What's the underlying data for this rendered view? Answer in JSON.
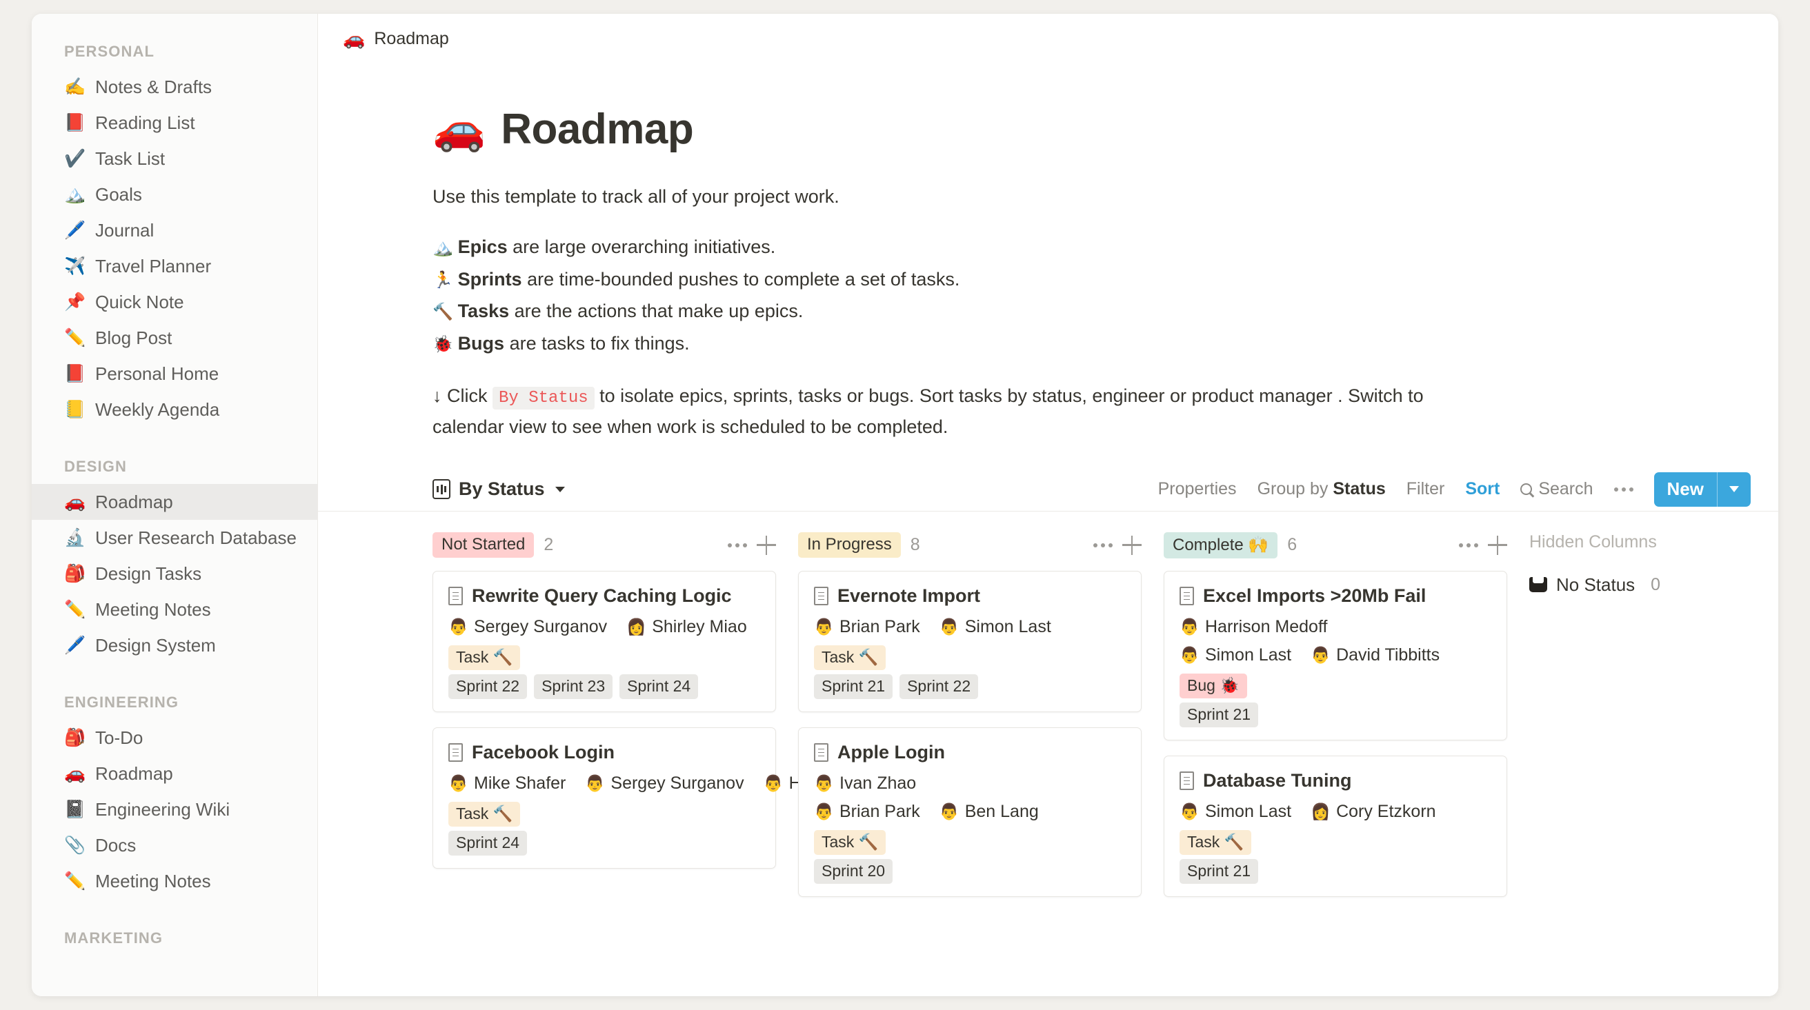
{
  "sidebar": {
    "sections": [
      {
        "title": "PERSONAL",
        "items": [
          {
            "emoji": "✍️",
            "label": "Notes & Drafts",
            "icon": "writing-hand-icon",
            "active": false
          },
          {
            "emoji": "📕",
            "label": "Reading List",
            "icon": "closed-book-icon",
            "active": false
          },
          {
            "emoji": "✔️",
            "label": "Task List",
            "icon": "check-mark-icon",
            "active": false
          },
          {
            "emoji": "🏔️",
            "label": "Goals",
            "icon": "mountain-icon",
            "active": false
          },
          {
            "emoji": "🖊️",
            "label": "Journal",
            "icon": "pen-icon",
            "active": false
          },
          {
            "emoji": "✈️",
            "label": "Travel Planner",
            "icon": "airplane-icon",
            "active": false
          },
          {
            "emoji": "📌",
            "label": "Quick Note",
            "icon": "pushpin-icon",
            "active": false
          },
          {
            "emoji": "✏️",
            "label": "Blog Post",
            "icon": "pencil-icon",
            "active": false
          },
          {
            "emoji": "📕",
            "label": "Personal Home",
            "icon": "closed-book-icon",
            "active": false
          },
          {
            "emoji": "📒",
            "label": "Weekly Agenda",
            "icon": "ledger-icon",
            "active": false
          }
        ]
      },
      {
        "title": "DESIGN",
        "items": [
          {
            "emoji": "🚗",
            "label": "Roadmap",
            "icon": "car-icon",
            "active": true
          },
          {
            "emoji": "🔬",
            "label": "User Research Database",
            "icon": "microscope-icon",
            "active": false
          },
          {
            "emoji": "🎒",
            "label": "Design Tasks",
            "icon": "backpack-icon",
            "active": false
          },
          {
            "emoji": "✏️",
            "label": "Meeting Notes",
            "icon": "pencil-icon",
            "active": false
          },
          {
            "emoji": "🖊️",
            "label": "Design System",
            "icon": "pen-icon",
            "active": false
          }
        ]
      },
      {
        "title": "ENGINEERING",
        "items": [
          {
            "emoji": "🎒",
            "label": "To-Do",
            "icon": "backpack-icon",
            "active": false
          },
          {
            "emoji": "🚗",
            "label": "Roadmap",
            "icon": "car-icon",
            "active": false
          },
          {
            "emoji": "📓",
            "label": "Engineering Wiki",
            "icon": "notebook-icon",
            "active": false
          },
          {
            "emoji": "📎",
            "label": "Docs",
            "icon": "paperclip-icon",
            "active": false
          },
          {
            "emoji": "✏️",
            "label": "Meeting Notes",
            "icon": "pencil-icon",
            "active": false
          }
        ]
      },
      {
        "title": "MARKETING",
        "items": []
      }
    ]
  },
  "topbar": {
    "emoji": "🚗",
    "title": "Roadmap"
  },
  "page": {
    "emoji": "🚗",
    "title": "Roadmap",
    "intro": "Use this template to track all of your project work.",
    "bullets": [
      {
        "emoji": "🏔️",
        "term": "Epics",
        "rest": " are large overarching initiatives."
      },
      {
        "emoji": "🏃",
        "term": "Sprints",
        "rest": " are time-bounded pushes to complete a set of tasks."
      },
      {
        "emoji": "🔨",
        "term": "Tasks",
        "rest": " are the actions that make up epics."
      },
      {
        "emoji": "🐞",
        "term": "Bugs",
        "rest": " are tasks to fix things."
      }
    ],
    "hint_prefix": "↓ Click ",
    "hint_chip": "By Status",
    "hint_suffix": " to isolate epics, sprints, tasks or bugs. Sort tasks by status, engineer or product manager . Switch to calendar view to see when work is scheduled to be completed."
  },
  "viewbar": {
    "view_name": "By Status",
    "properties": "Properties",
    "group_by_prefix": "Group by ",
    "group_by_value": "Status",
    "filter": "Filter",
    "sort": "Sort",
    "search": "Search",
    "new_label": "New",
    "accent_color": "#2f9fd8",
    "new_button_color": "#3ba7dd"
  },
  "board": {
    "columns": [
      {
        "name": "Not Started",
        "count": "2",
        "pill_color": "#ffcfcf",
        "cards": [
          {
            "title": "Rewrite Query Caching Logic",
            "people": [
              {
                "emoji": "👨",
                "name": "Sergey Surganov"
              },
              {
                "emoji": "👩",
                "name": "Shirley Miao"
              }
            ],
            "people_rows": [
              1,
              1
            ],
            "type_tag": "Task 🔨",
            "type_kind": "type",
            "sprints": [
              "Sprint 22",
              "Sprint 23",
              "Sprint 24"
            ]
          },
          {
            "title": "Facebook Login",
            "people": [
              {
                "emoji": "👨",
                "name": "Mike Shafer"
              },
              {
                "emoji": "👨",
                "name": "Sergey Surganov"
              },
              {
                "emoji": "👨",
                "name": "Harrison Medoff"
              }
            ],
            "people_rows": [
              1,
              1,
              1
            ],
            "type_tag": "Task 🔨",
            "type_kind": "type",
            "sprints": [
              "Sprint 24"
            ]
          }
        ]
      },
      {
        "name": "In Progress",
        "count": "8",
        "pill_color": "#faecc8",
        "cards": [
          {
            "title": "Evernote Import",
            "people": [
              {
                "emoji": "👨",
                "name": "Brian Park"
              },
              {
                "emoji": "👨",
                "name": "Simon Last"
              }
            ],
            "people_rows": [
              1,
              1
            ],
            "type_tag": "Task 🔨",
            "type_kind": "type",
            "sprints": [
              "Sprint 21",
              "Sprint 22"
            ]
          },
          {
            "title": "Apple Login",
            "people": [
              {
                "emoji": "👨",
                "name": "Ivan Zhao"
              },
              {
                "emoji": "👨",
                "name": "Brian Park"
              },
              {
                "emoji": "👨",
                "name": "Ben Lang"
              }
            ],
            "people_rows": [
              1,
              2,
              2
            ],
            "type_tag": "Task 🔨",
            "type_kind": "type",
            "sprints": [
              "Sprint 20"
            ]
          }
        ]
      },
      {
        "name": "Complete 🙌",
        "count": "6",
        "pill_color": "#d3e9e3",
        "cards": [
          {
            "title": "Excel Imports >20Mb Fail",
            "people": [
              {
                "emoji": "👨",
                "name": "Harrison Medoff"
              },
              {
                "emoji": "👨",
                "name": "Simon Last"
              },
              {
                "emoji": "👨",
                "name": "David Tibbitts"
              }
            ],
            "people_rows": [
              1,
              2,
              2
            ],
            "type_tag": "Bug 🐞",
            "type_kind": "bug",
            "sprints": [
              "Sprint 21"
            ]
          },
          {
            "title": "Database Tuning",
            "people": [
              {
                "emoji": "👨",
                "name": "Simon Last"
              },
              {
                "emoji": "👩",
                "name": "Cory Etzkorn"
              }
            ],
            "people_rows": [
              1,
              1
            ],
            "type_tag": "Task 🔨",
            "type_kind": "type",
            "sprints": [
              "Sprint 21"
            ]
          }
        ]
      }
    ],
    "hidden": {
      "title": "Hidden Columns",
      "label": "No Status",
      "count": "0"
    }
  }
}
